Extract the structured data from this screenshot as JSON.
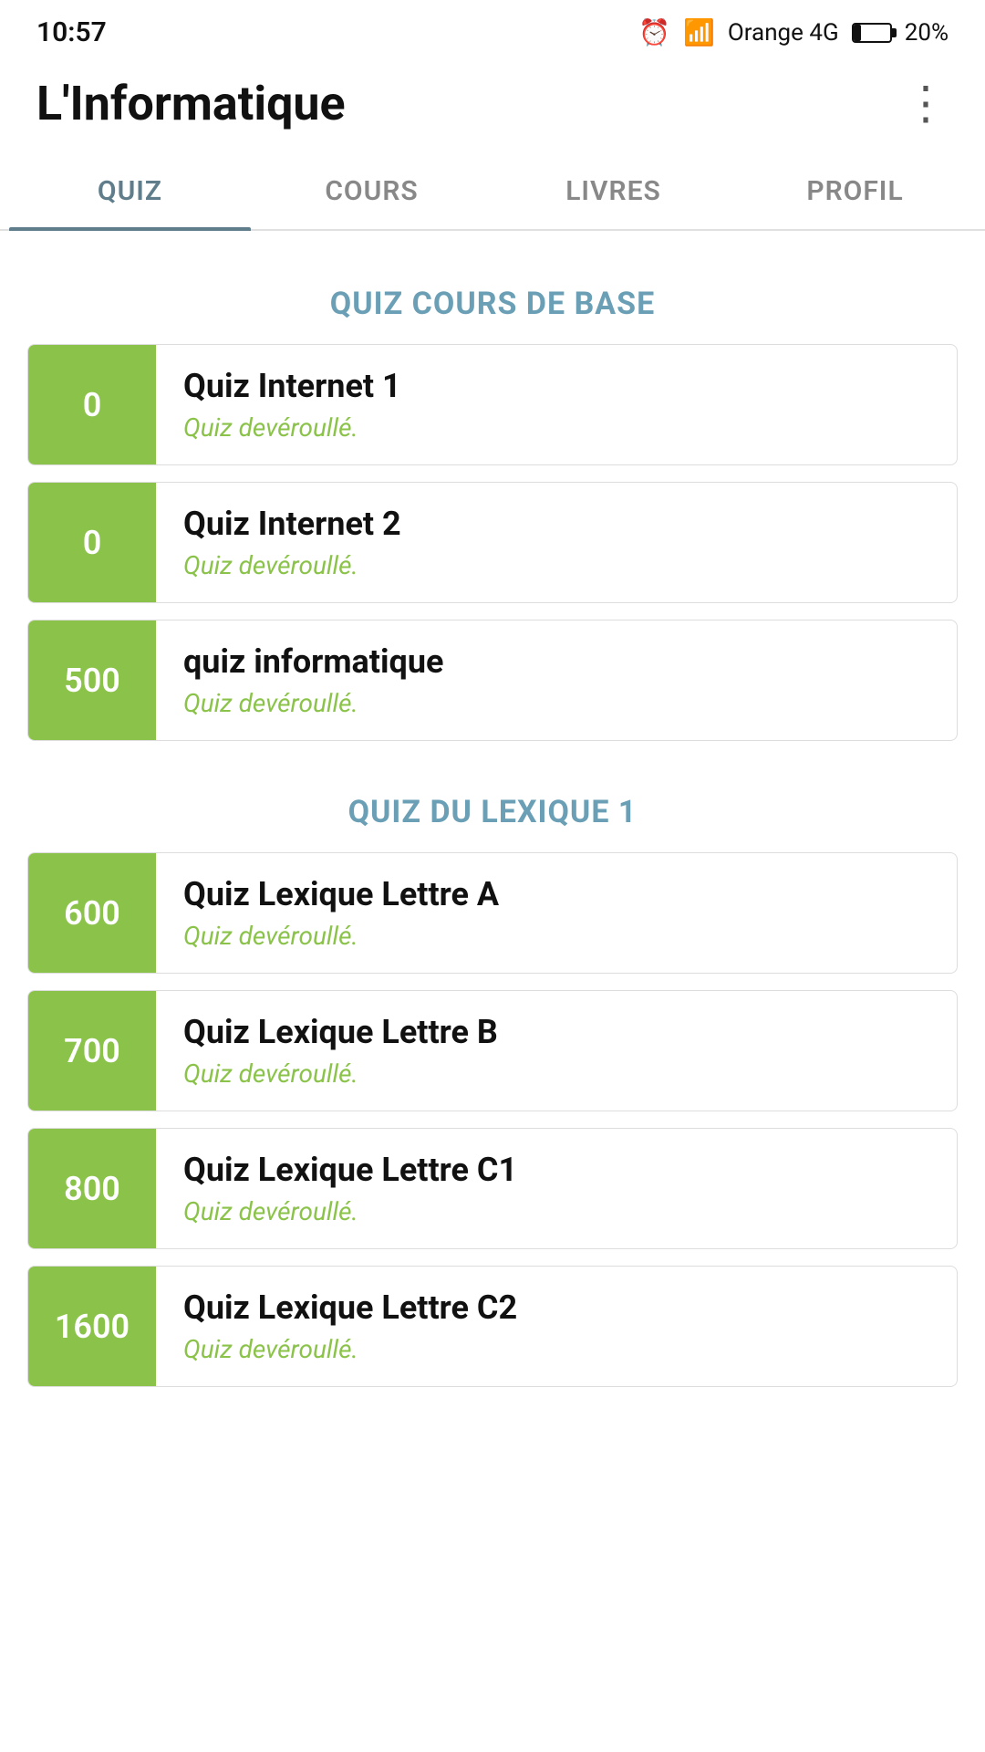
{
  "statusBar": {
    "time": "10:57",
    "carrier": "Orange 4G",
    "battery": "20%"
  },
  "header": {
    "title": "L'Informatique",
    "moreIcon": "⋮"
  },
  "tabs": [
    {
      "id": "quiz",
      "label": "QUIZ",
      "active": true
    },
    {
      "id": "cours",
      "label": "COURS",
      "active": false
    },
    {
      "id": "livres",
      "label": "LIVRES",
      "active": false
    },
    {
      "id": "profil",
      "label": "PROFIL",
      "active": false
    }
  ],
  "sections": [
    {
      "id": "cours-de-base",
      "title": "QUIZ COURS DE BASE",
      "items": [
        {
          "id": "qi1",
          "score": "0",
          "title": "Quiz Internet 1",
          "status": "Quiz devéroullé."
        },
        {
          "id": "qi2",
          "score": "0",
          "title": "Quiz Internet 2",
          "status": "Quiz devéroullé."
        },
        {
          "id": "qinf",
          "score": "500",
          "title": "quiz informatique",
          "status": "Quiz devéroullé."
        }
      ]
    },
    {
      "id": "lexique-1",
      "title": "QUIZ DU LEXIQUE 1",
      "items": [
        {
          "id": "qla",
          "score": "600",
          "title": "Quiz Lexique Lettre A",
          "status": "Quiz devéroullé."
        },
        {
          "id": "qlb",
          "score": "700",
          "title": "Quiz Lexique Lettre B",
          "status": "Quiz devéroullé."
        },
        {
          "id": "qlc1",
          "score": "800",
          "title": "Quiz Lexique Lettre C1",
          "status": "Quiz devéroullé."
        },
        {
          "id": "qlc2",
          "score": "1600",
          "title": "Quiz Lexique Lettre C2",
          "status": "Quiz devéroullé."
        }
      ]
    }
  ]
}
